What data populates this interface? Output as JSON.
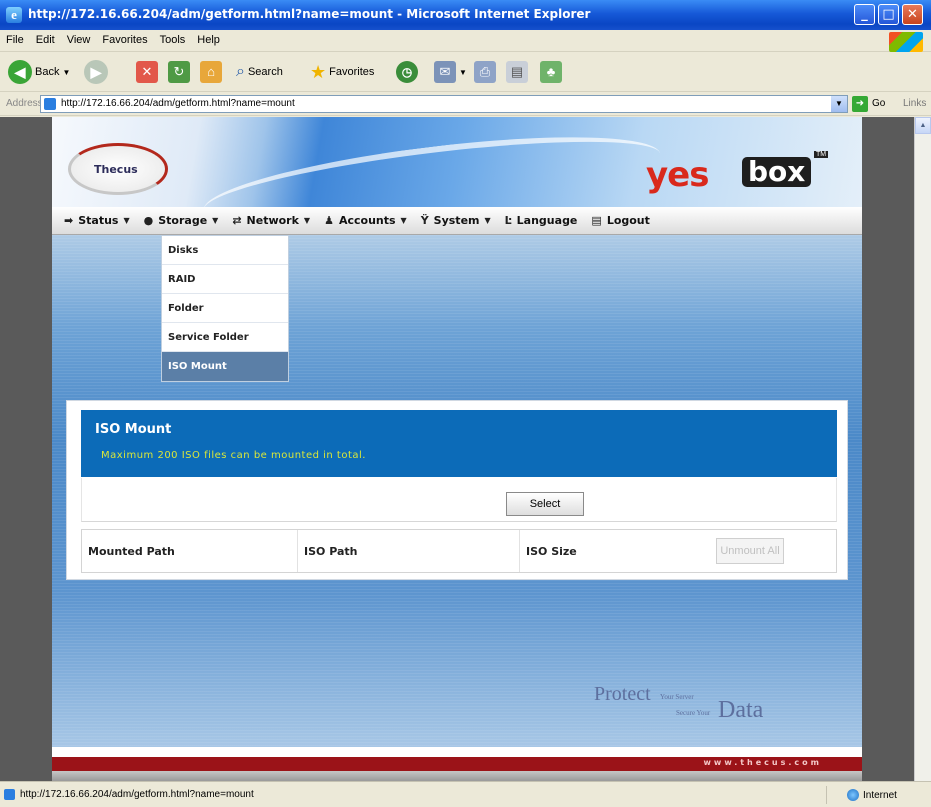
{
  "window": {
    "title": "http://172.16.66.204/adm/getform.html?name=mount - Microsoft Internet Explorer",
    "minimize": "_",
    "maximize": "□",
    "close": "✕"
  },
  "menubar": {
    "items": [
      "File",
      "Edit",
      "View",
      "Favorites",
      "Tools",
      "Help"
    ]
  },
  "toolbar": {
    "back": "Back",
    "search": "Search",
    "favorites": "Favorites"
  },
  "address": {
    "label": "Address",
    "url": "http://172.16.66.204/adm/getform.html?name=mount",
    "go": "Go",
    "links": "Links"
  },
  "brand": {
    "thecus": "Thecus",
    "yes": "yes",
    "box": "box",
    "tm": "TM"
  },
  "nav": {
    "items": [
      {
        "label": "Status",
        "icon": "arrow-icon"
      },
      {
        "label": "Storage",
        "icon": "disk-icon"
      },
      {
        "label": "Network",
        "icon": "network-icon"
      },
      {
        "label": "Accounts",
        "icon": "users-icon"
      },
      {
        "label": "System",
        "icon": "tools-icon"
      },
      {
        "label": "Language",
        "icon": "language-icon"
      },
      {
        "label": "Logout",
        "icon": "logout-icon"
      }
    ]
  },
  "storage_menu": {
    "items": [
      "Disks",
      "RAID",
      "Folder",
      "Service Folder",
      "ISO Mount"
    ],
    "active": "ISO Mount"
  },
  "iso": {
    "title": "ISO Mount",
    "subtitle": "Maximum 200 ISO files can be mounted in total.",
    "select_button": "Select",
    "columns": [
      "Mounted Path",
      "ISO Path",
      "ISO Size"
    ],
    "unmount_all": "Unmount All"
  },
  "footer": {
    "protect": "Protect",
    "your_server": "Your Server",
    "secure_your": "Secure Your",
    "data": "Data",
    "website": "www.thecus.com"
  },
  "statusbar": {
    "text": "http://172.16.66.204/adm/getform.html?name=mount",
    "zone": "Internet"
  }
}
